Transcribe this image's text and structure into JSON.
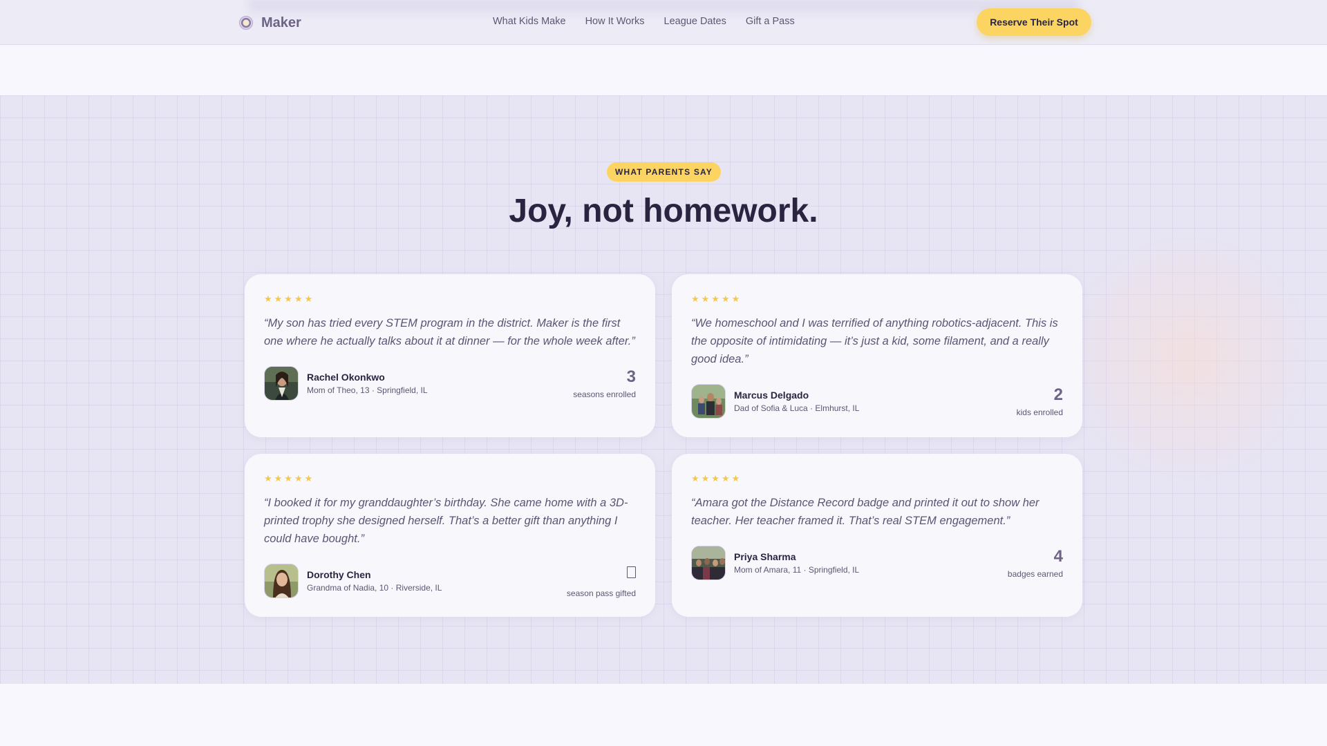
{
  "nav": {
    "brand": "Maker",
    "links": [
      "What Kids Make",
      "How It Works",
      "League Dates",
      "Gift a Pass"
    ],
    "cta": "Reserve Their Spot"
  },
  "section": {
    "eyebrow": "WHAT PARENTS SAY",
    "title": "Joy, not homework."
  },
  "colors": {
    "accent_yellow": "#fcd462",
    "brand_purple": "#6d6387",
    "star": "#f4c84c"
  },
  "testimonials": [
    {
      "stars": "★★★★★",
      "quote": "“My son has tried every STEM program in the district. Maker is the first one where he actually talks about it at dinner — for the whole week after.”",
      "name": "Rachel Okonkwo",
      "meta": "Mom of Theo, 13 · Springfield, IL",
      "stat": "3",
      "stat_label": "seasons enrolled"
    },
    {
      "stars": "★★★★★",
      "quote": "“We homeschool and I was terrified of anything robotics-adjacent. This is the opposite of intimidating — it’s just a kid, some filament, and a really good idea.”",
      "name": "Marcus Delgado",
      "meta": "Dad of Sofia & Luca · Elmhurst, IL",
      "stat": "2",
      "stat_label": "kids enrolled"
    },
    {
      "stars": "★★★★★",
      "quote": "“I booked it for my granddaughter’s birthday. She came home with a 3D-printed trophy she designed herself. That’s a better gift than anything I could have bought.”",
      "name": "Dorothy Chen",
      "meta": "Grandma of Nadia, 10 · Riverside, IL",
      "stat_icon": "gift-icon",
      "stat_label": "season pass gifted"
    },
    {
      "stars": "★★★★★",
      "quote": "“Amara got the Distance Record badge and printed it out to show her teacher. Her teacher framed it. That’s real STEM engagement.”",
      "name": "Priya Sharma",
      "meta": "Mom of Amara, 11 · Springfield, IL",
      "stat": "4",
      "stat_label": "badges earned"
    }
  ]
}
